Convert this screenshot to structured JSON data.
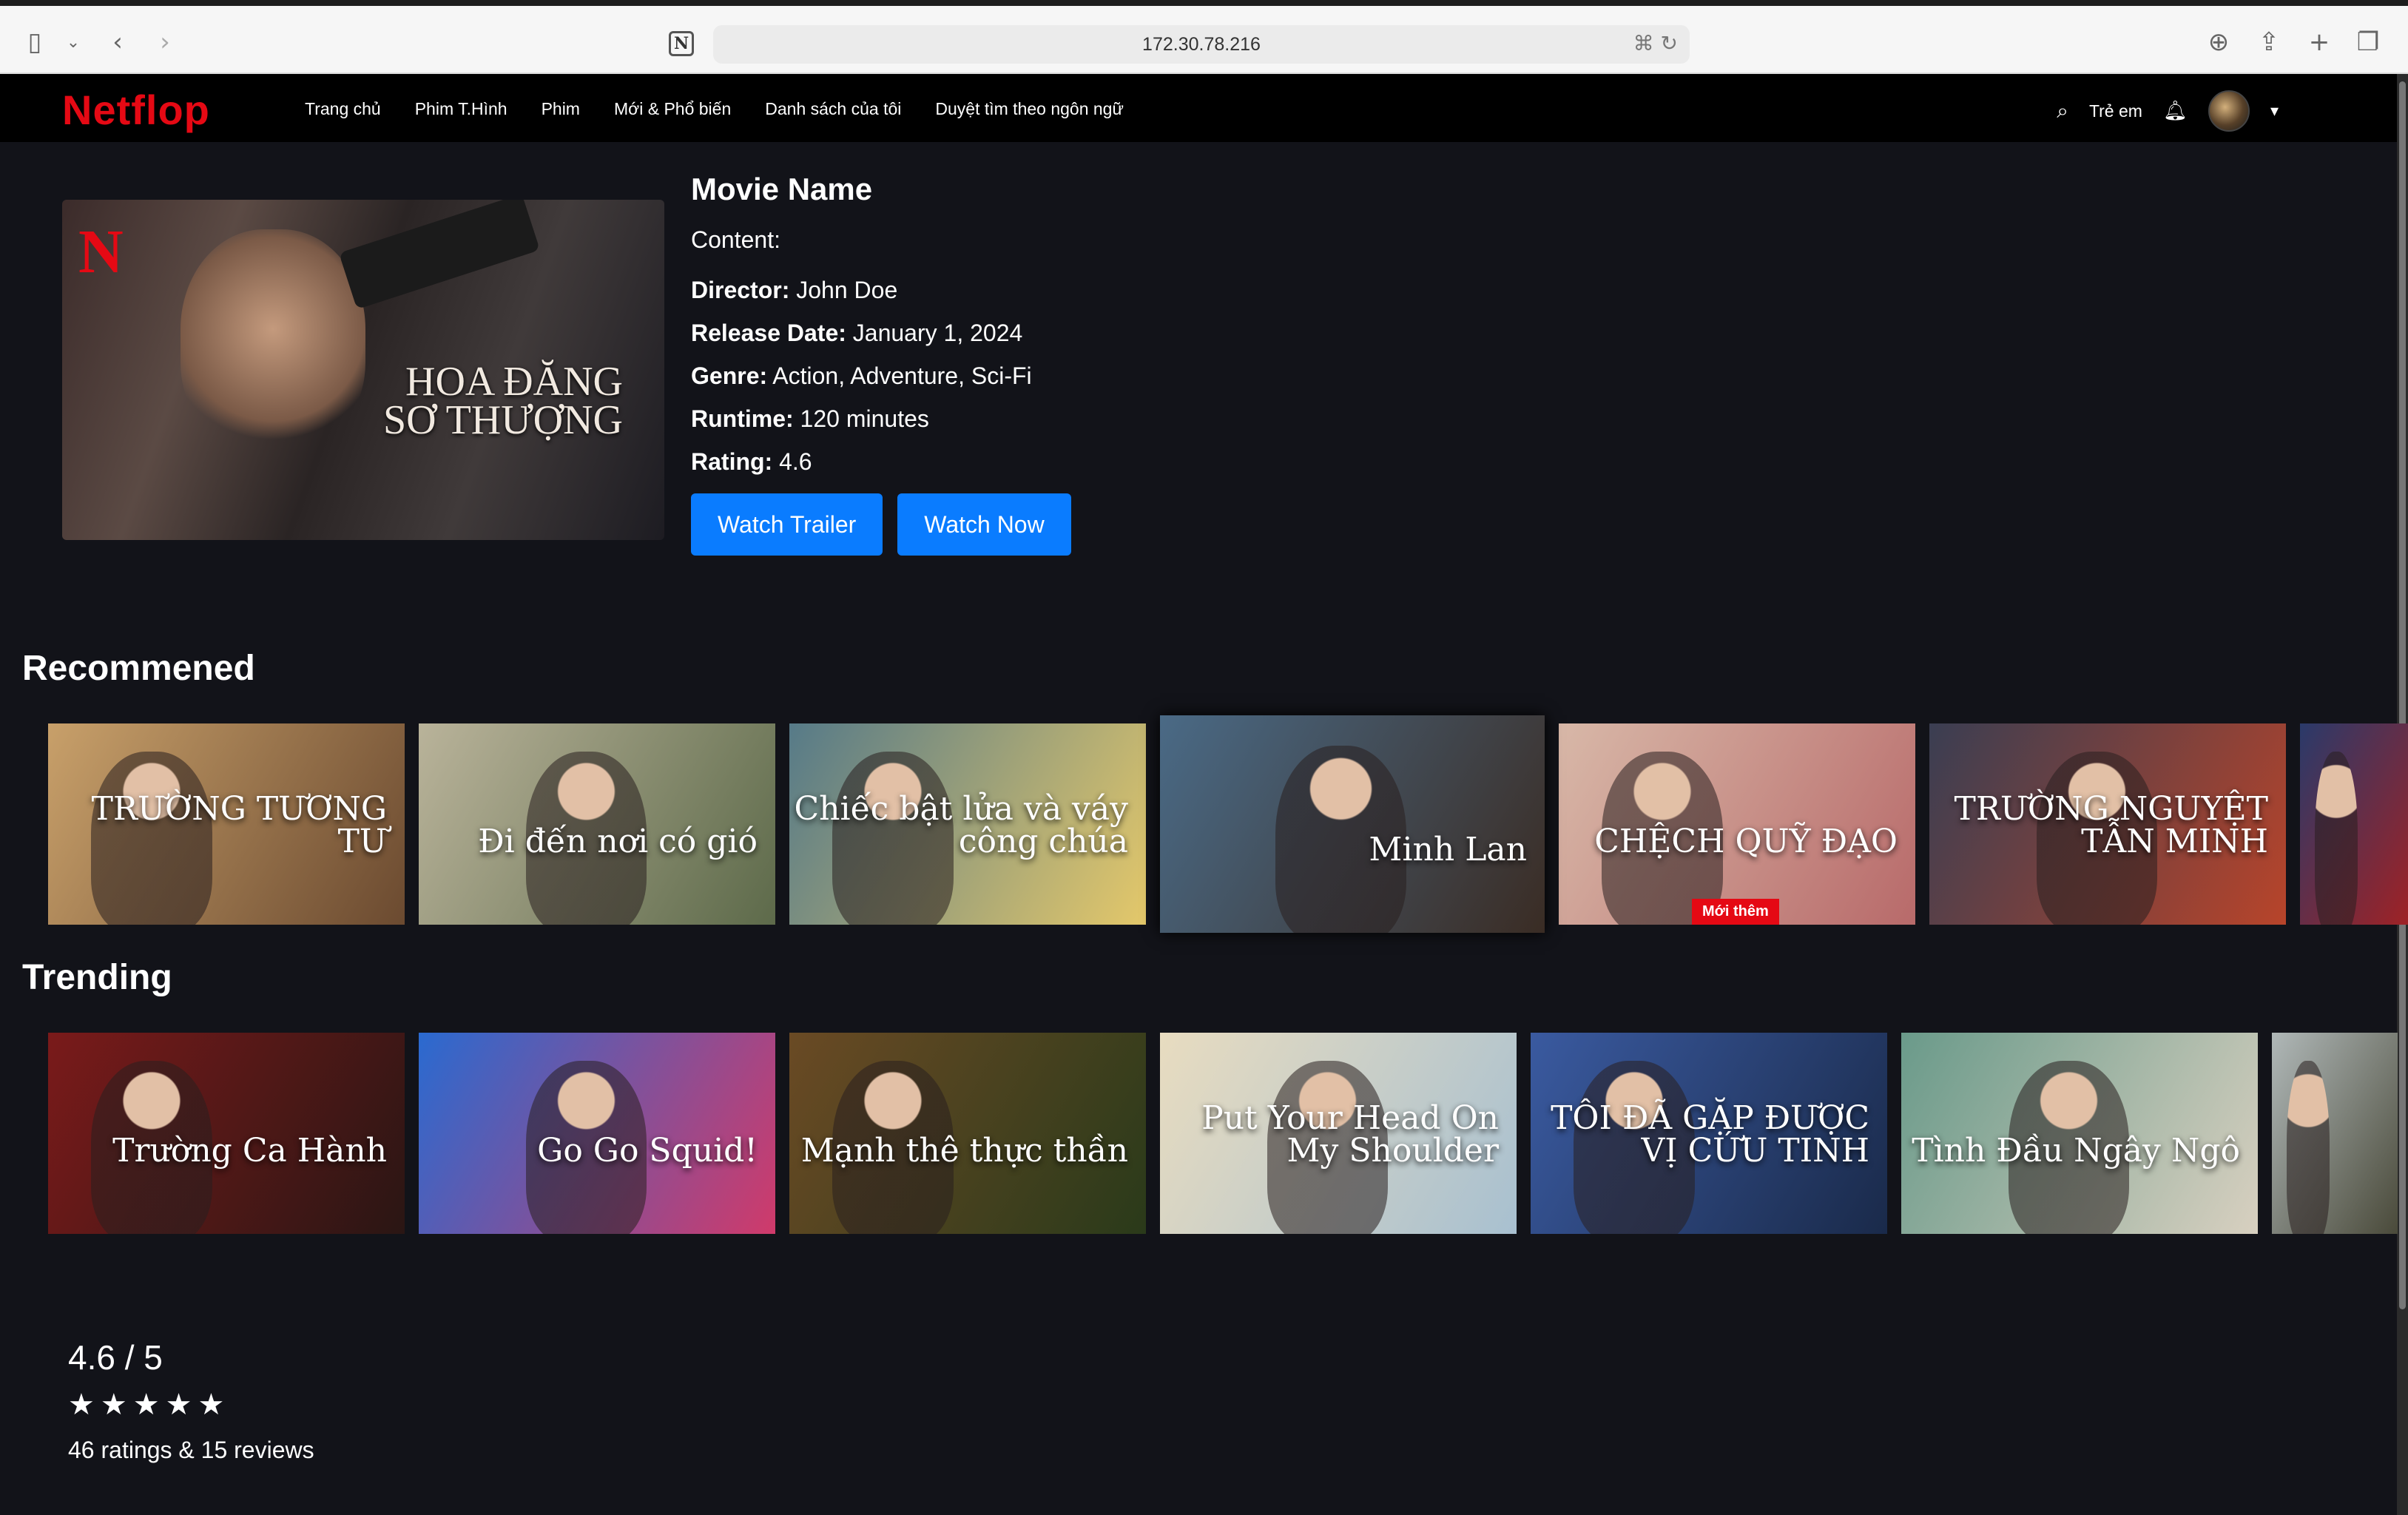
{
  "browser": {
    "url": "172.30.78.216",
    "icons": {
      "sidebar": "sidebar-icon",
      "back": "chevron-left-icon",
      "forward": "chevron-right-icon",
      "notion": "notion-icon",
      "translate": "translate-icon",
      "reload": "reload-icon",
      "download": "download-icon",
      "share": "share-icon",
      "new_tab": "plus-icon",
      "tabs": "tabs-overview-icon"
    }
  },
  "header": {
    "logo": "Netflop",
    "nav": [
      "Trang chủ",
      "Phim T.Hình",
      "Phim",
      "Mới & Phổ biến",
      "Danh sách của tôi",
      "Duyệt tìm theo ngôn ngữ"
    ],
    "kids": "Trẻ em",
    "colors": {
      "brand": "#e50914"
    }
  },
  "movie": {
    "name": "Movie Name",
    "poster_title": [
      "HOA ĐĂNG",
      "SƠ THƯỢNG"
    ],
    "content_label": "Content:",
    "director_label": "Director:",
    "director": "John Doe",
    "release_label": "Release Date:",
    "release": "January 1, 2024",
    "genre_label": "Genre:",
    "genre": "Action, Adventure, Sci-Fi",
    "runtime_label": "Runtime:",
    "runtime": "120 minutes",
    "rating_label": "Rating:",
    "rating": "4.6",
    "watch_trailer": "Watch Trailer",
    "watch_now": "Watch Now",
    "button_color": "#0a7cff"
  },
  "recommended": {
    "title": "Recommened",
    "items": [
      {
        "title": "TRƯỜNG TƯƠNG TƯ",
        "color1": "#c8a06a",
        "color2": "#6b4a30",
        "badge": ""
      },
      {
        "title": "Đi đến nơi có gió",
        "color1": "#b9b39a",
        "color2": "#5d6a4a",
        "badge": ""
      },
      {
        "title": "Chiếc bật lửa và váy công chúa",
        "color1": "#567a88",
        "color2": "#e4c86a",
        "badge": ""
      },
      {
        "title": "Minh Lan",
        "color1": "#4a6a86",
        "color2": "#3a2c24",
        "badge": ""
      },
      {
        "title": "CHỆCH QUỸ ĐẠO",
        "color1": "#d8b8a8",
        "color2": "#b86a6a",
        "badge": "Mới thêm"
      },
      {
        "title": "TRƯỜNG NGUYỆT TẪN MINH",
        "color1": "#3a3e52",
        "color2": "#b8442a",
        "badge": ""
      },
      {
        "title": "",
        "color1": "#2a3a6a",
        "color2": "#a82020",
        "badge": ""
      }
    ]
  },
  "trending": {
    "title": "Trending",
    "items": [
      {
        "title": "Trường Ca Hành",
        "color1": "#7a1a1a",
        "color2": "#2a1614"
      },
      {
        "title": "Go Go Squid!",
        "color1": "#2a6ad0",
        "color2": "#d03a6a"
      },
      {
        "title": "Mạnh thê thực thần",
        "color1": "#6a4a24",
        "color2": "#2a3a1a"
      },
      {
        "title": "Put Your Head On My Shoulder",
        "color1": "#e8dcc0",
        "color2": "#a8c0d0"
      },
      {
        "title": "TÔI ĐÃ GẶP ĐƯỢC VỊ CỨU TINH",
        "color1": "#3a5aa0",
        "color2": "#1a2a4a"
      },
      {
        "title": "Tình Đầu Ngây Ngô",
        "color1": "#6a9a8a",
        "color2": "#d8d0c0"
      },
      {
        "title": "",
        "color1": "#b0b8b8",
        "color2": "#4a4a3a"
      }
    ]
  },
  "rating_summary": {
    "score": "4.6 / 5",
    "stars": 5,
    "text": "46 ratings & 15 reviews"
  }
}
